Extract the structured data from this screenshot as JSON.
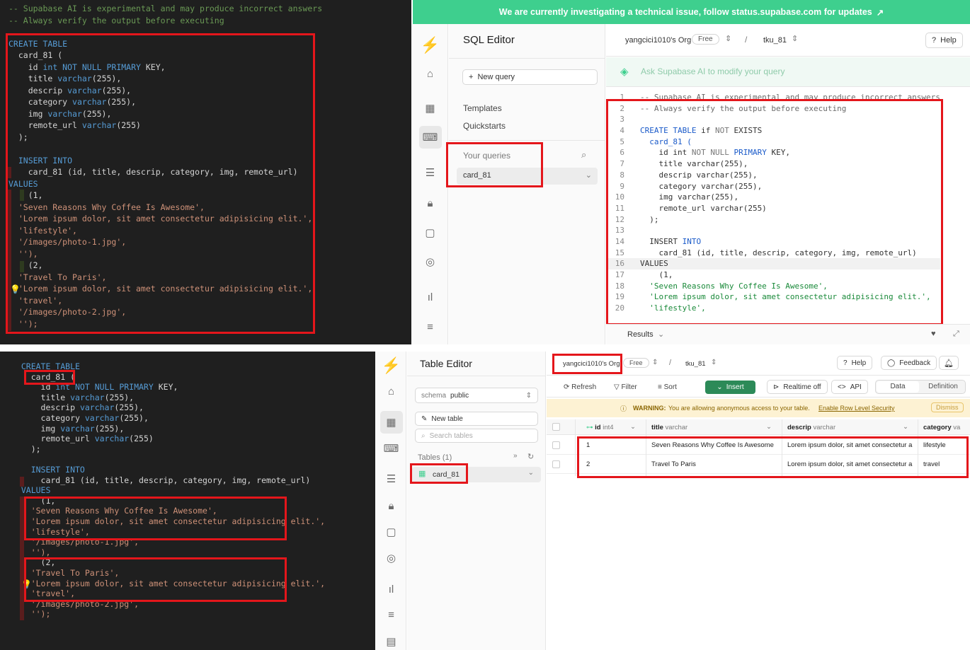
{
  "vs_top": {
    "lines": [
      {
        "parts": [
          {
            "t": "-- ",
            "c": "cm"
          },
          {
            "t": "Supabase",
            "c": "cm"
          },
          {
            "t": " AI is experimental and may produce incorrect answers",
            "c": "cm"
          }
        ]
      },
      {
        "parts": [
          {
            "t": "-- Always verify the output before executing",
            "c": "cm"
          }
        ]
      },
      {
        "parts": []
      },
      {
        "parts": [
          {
            "t": "CREATE TABLE",
            "c": "kw"
          }
        ]
      },
      {
        "parts": [
          {
            "t": "  card_81 (",
            "c": "pl"
          }
        ]
      },
      {
        "parts": [
          {
            "t": "    id ",
            "c": "pl"
          },
          {
            "t": "int NOT NULL PRIMARY",
            "c": "kw"
          },
          {
            "t": " KEY,",
            "c": "pl"
          }
        ]
      },
      {
        "parts": [
          {
            "t": "    title ",
            "c": "pl"
          },
          {
            "t": "varchar",
            "c": "kw"
          },
          {
            "t": "(255),",
            "c": "pl"
          }
        ]
      },
      {
        "parts": [
          {
            "t": "    descrip ",
            "c": "pl"
          },
          {
            "t": "varchar",
            "c": "kw"
          },
          {
            "t": "(255),",
            "c": "pl"
          }
        ]
      },
      {
        "parts": [
          {
            "t": "    category ",
            "c": "pl"
          },
          {
            "t": "varchar",
            "c": "kw"
          },
          {
            "t": "(255),",
            "c": "pl"
          }
        ]
      },
      {
        "parts": [
          {
            "t": "    img ",
            "c": "pl"
          },
          {
            "t": "varchar",
            "c": "kw"
          },
          {
            "t": "(255),",
            "c": "pl"
          }
        ]
      },
      {
        "parts": [
          {
            "t": "    remote_url ",
            "c": "pl"
          },
          {
            "t": "varchar",
            "c": "kw"
          },
          {
            "t": "(255)",
            "c": "pl"
          }
        ]
      },
      {
        "parts": [
          {
            "t": "  );",
            "c": "pl"
          }
        ]
      },
      {
        "parts": []
      },
      {
        "parts": [
          {
            "t": "  INSERT INTO",
            "c": "kw"
          }
        ]
      },
      {
        "parts": [
          {
            "t": "    card_81 (id, title, descrip, category, img, remote_url)",
            "c": "pl"
          }
        ]
      },
      {
        "parts": [
          {
            "t": "VALUES",
            "c": "kw"
          }
        ]
      },
      {
        "parts": [
          {
            "t": "    (1,",
            "c": "pl"
          }
        ]
      },
      {
        "parts": [
          {
            "t": "  'Seven Reasons Why Coffee Is Awesome',",
            "c": "st"
          }
        ]
      },
      {
        "parts": [
          {
            "t": "  'Lorem ipsum dolor, sit amet consectetur adipisicing elit.',",
            "c": "st"
          }
        ]
      },
      {
        "parts": [
          {
            "t": "  'lifestyle',",
            "c": "st"
          }
        ]
      },
      {
        "parts": [
          {
            "t": "  '/images/photo-1.jpg',",
            "c": "st"
          }
        ]
      },
      {
        "parts": [
          {
            "t": "  ''),",
            "c": "st"
          }
        ]
      },
      {
        "parts": [
          {
            "t": "    (2,",
            "c": "pl"
          }
        ]
      },
      {
        "parts": [
          {
            "t": "  'Travel To Paris',",
            "c": "st"
          }
        ]
      },
      {
        "parts": [
          {
            "t": "  'Lorem ipsum dolor, sit amet consectetur adipisicing elit.',",
            "c": "st"
          }
        ]
      },
      {
        "parts": [
          {
            "t": "  'travel',",
            "c": "st"
          }
        ]
      },
      {
        "parts": [
          {
            "t": "  '/images/photo-2.jpg',",
            "c": "st"
          }
        ]
      },
      {
        "parts": [
          {
            "t": "  '');",
            "c": "st"
          }
        ]
      }
    ]
  },
  "vs_bottom": {
    "lines": [
      {
        "parts": [
          {
            "t": "  CREATE TABLE",
            "c": "kw"
          }
        ]
      },
      {
        "parts": [
          {
            "t": "    card_81 (",
            "c": "pl"
          }
        ]
      },
      {
        "parts": [
          {
            "t": "      id ",
            "c": "pl"
          },
          {
            "t": "int NOT NULL PRIMARY",
            "c": "kw"
          },
          {
            "t": " KEY,",
            "c": "pl"
          }
        ]
      },
      {
        "parts": [
          {
            "t": "      title ",
            "c": "pl"
          },
          {
            "t": "varchar",
            "c": "kw"
          },
          {
            "t": "(255),",
            "c": "pl"
          }
        ]
      },
      {
        "parts": [
          {
            "t": "      descrip ",
            "c": "pl"
          },
          {
            "t": "varchar",
            "c": "kw"
          },
          {
            "t": "(255),",
            "c": "pl"
          }
        ]
      },
      {
        "parts": [
          {
            "t": "      category ",
            "c": "pl"
          },
          {
            "t": "varchar",
            "c": "kw"
          },
          {
            "t": "(255),",
            "c": "pl"
          }
        ]
      },
      {
        "parts": [
          {
            "t": "      img ",
            "c": "pl"
          },
          {
            "t": "varchar",
            "c": "kw"
          },
          {
            "t": "(255),",
            "c": "pl"
          }
        ]
      },
      {
        "parts": [
          {
            "t": "      remote_url ",
            "c": "pl"
          },
          {
            "t": "varchar",
            "c": "kw"
          },
          {
            "t": "(255)",
            "c": "pl"
          }
        ]
      },
      {
        "parts": [
          {
            "t": "    );",
            "c": "pl"
          }
        ]
      },
      {
        "parts": []
      },
      {
        "parts": [
          {
            "t": "    INSERT INTO",
            "c": "kw"
          }
        ]
      },
      {
        "parts": [
          {
            "t": "      card_81 (id, title, descrip, category, img, remote_url)",
            "c": "pl"
          }
        ]
      },
      {
        "parts": [
          {
            "t": "  VALUES",
            "c": "kw"
          }
        ]
      },
      {
        "parts": [
          {
            "t": "      (1,",
            "c": "pl"
          }
        ]
      },
      {
        "parts": [
          {
            "t": "    'Seven Reasons Why Coffee Is Awesome',",
            "c": "st"
          }
        ]
      },
      {
        "parts": [
          {
            "t": "    'Lorem ipsum dolor, sit amet consectetur adipisicing elit.',",
            "c": "st"
          }
        ]
      },
      {
        "parts": [
          {
            "t": "    'lifestyle',",
            "c": "st"
          }
        ]
      },
      {
        "parts": [
          {
            "t": "    '/images/photo-1.jpg',",
            "c": "st"
          }
        ]
      },
      {
        "parts": [
          {
            "t": "    ''),",
            "c": "st"
          }
        ]
      },
      {
        "parts": [
          {
            "t": "      (2,",
            "c": "pl"
          }
        ]
      },
      {
        "parts": [
          {
            "t": "    'Travel To Paris',",
            "c": "st"
          }
        ]
      },
      {
        "parts": [
          {
            "t": "    'Lorem ipsum dolor, sit amet consectetur adipisicing elit.',",
            "c": "st"
          }
        ]
      },
      {
        "parts": [
          {
            "t": "    'travel',",
            "c": "st"
          }
        ]
      },
      {
        "parts": [
          {
            "t": "    '/images/photo-2.jpg',",
            "c": "st"
          }
        ]
      },
      {
        "parts": [
          {
            "t": "    '');",
            "c": "st"
          }
        ]
      }
    ]
  },
  "banner": {
    "text": "We are currently investigating a technical issue, follow status.supabase.com for updates",
    "bg": "#3ecf8e"
  },
  "sql_editor": {
    "title": "SQL Editor",
    "org": "yangcici1010's Org",
    "plan": "Free",
    "project": "tku_81",
    "help": "Help",
    "new_query": "New query",
    "templates": "Templates",
    "quickstarts": "Quickstarts",
    "your_queries": "Your queries",
    "query_item": "card_81",
    "ai_prompt": "Ask Supabase AI to modify your query",
    "results": "Results",
    "lines": [
      {
        "n": "1",
        "parts": [
          {
            "t": "-- Supabase AI is experimental and may produce incorrect answers",
            "c": "cm"
          }
        ]
      },
      {
        "n": "2",
        "parts": [
          {
            "t": "-- Always verify the output before executing",
            "c": "cm"
          }
        ]
      },
      {
        "n": "3",
        "parts": []
      },
      {
        "n": "4",
        "parts": [
          {
            "t": "CREATE TABLE",
            "c": "kw"
          },
          {
            "t": " if ",
            "c": "pl"
          },
          {
            "t": "NOT",
            "c": "gr"
          },
          {
            "t": " EXISTS",
            "c": "pl"
          }
        ]
      },
      {
        "n": "5",
        "parts": [
          {
            "t": "  card_81 (",
            "c": "kw"
          }
        ]
      },
      {
        "n": "6",
        "parts": [
          {
            "t": "    id int ",
            "c": "pl"
          },
          {
            "t": "NOT NULL",
            "c": "gr"
          },
          {
            "t": " ",
            "c": "pl"
          },
          {
            "t": "PRIMARY",
            "c": "kw"
          },
          {
            "t": " KEY,",
            "c": "pl"
          }
        ]
      },
      {
        "n": "7",
        "parts": [
          {
            "t": "    title varchar(255),",
            "c": "pl"
          }
        ]
      },
      {
        "n": "8",
        "parts": [
          {
            "t": "    descrip varchar(255),",
            "c": "pl"
          }
        ]
      },
      {
        "n": "9",
        "parts": [
          {
            "t": "    category varchar(255),",
            "c": "pl"
          }
        ]
      },
      {
        "n": "10",
        "parts": [
          {
            "t": "    img varchar(255),",
            "c": "pl"
          }
        ]
      },
      {
        "n": "11",
        "parts": [
          {
            "t": "    remote_url varchar(255)",
            "c": "pl"
          }
        ]
      },
      {
        "n": "12",
        "parts": [
          {
            "t": "  );",
            "c": "pl"
          }
        ]
      },
      {
        "n": "13",
        "parts": []
      },
      {
        "n": "14",
        "parts": [
          {
            "t": "  INSERT ",
            "c": "pl"
          },
          {
            "t": "INTO",
            "c": "kw"
          }
        ]
      },
      {
        "n": "15",
        "parts": [
          {
            "t": "    card_81 (id, title, descrip, category, img, remote_url)",
            "c": "pl"
          }
        ]
      },
      {
        "n": "16",
        "parts": [
          {
            "t": "VALUES",
            "c": "pl"
          }
        ]
      },
      {
        "n": "17",
        "parts": [
          {
            "t": "    (1,",
            "c": "pl"
          }
        ]
      },
      {
        "n": "18",
        "parts": [
          {
            "t": "  'Seven Reasons Why Coffee Is Awesome',",
            "c": "st"
          }
        ]
      },
      {
        "n": "19",
        "parts": [
          {
            "t": "  'Lorem ipsum dolor, sit amet consectetur adipisicing elit.',",
            "c": "st"
          }
        ]
      },
      {
        "n": "20",
        "parts": [
          {
            "t": "  'lifestyle',",
            "c": "st"
          }
        ]
      }
    ]
  },
  "table_editor": {
    "title": "Table Editor",
    "org": "yangcici1010's Org",
    "plan": "Free",
    "project": "tku_81",
    "help": "Help",
    "feedback": "Feedback",
    "schema_label": "schema",
    "schema_value": "public",
    "new_table": "New table",
    "search_placeholder": "Search tables",
    "tables_label": "Tables (1)",
    "table_item": "card_81",
    "toolbar": {
      "refresh": "Refresh",
      "filter": "Filter",
      "sort": "Sort",
      "insert": "Insert",
      "realtime": "Realtime off",
      "api": "API",
      "data": "Data",
      "definition": "Definition"
    },
    "warning": {
      "label": "WARNING:",
      "text": "You are allowing anonymous access to your table.",
      "link": "Enable Row Level Security",
      "dismiss": "Dismiss"
    },
    "columns": [
      {
        "name": "id",
        "type": "int4"
      },
      {
        "name": "title",
        "type": "varchar"
      },
      {
        "name": "descrip",
        "type": "varchar"
      },
      {
        "name": "category",
        "type": "va"
      }
    ],
    "rows": [
      {
        "id": "1",
        "title": "Seven Reasons Why Coffee Is Awesome",
        "descrip": "Lorem ipsum dolor, sit amet consectetur a",
        "category": "lifestyle"
      },
      {
        "id": "2",
        "title": "Travel To Paris",
        "descrip": "Lorem ipsum dolor, sit amet consectetur a",
        "category": "travel"
      }
    ]
  }
}
